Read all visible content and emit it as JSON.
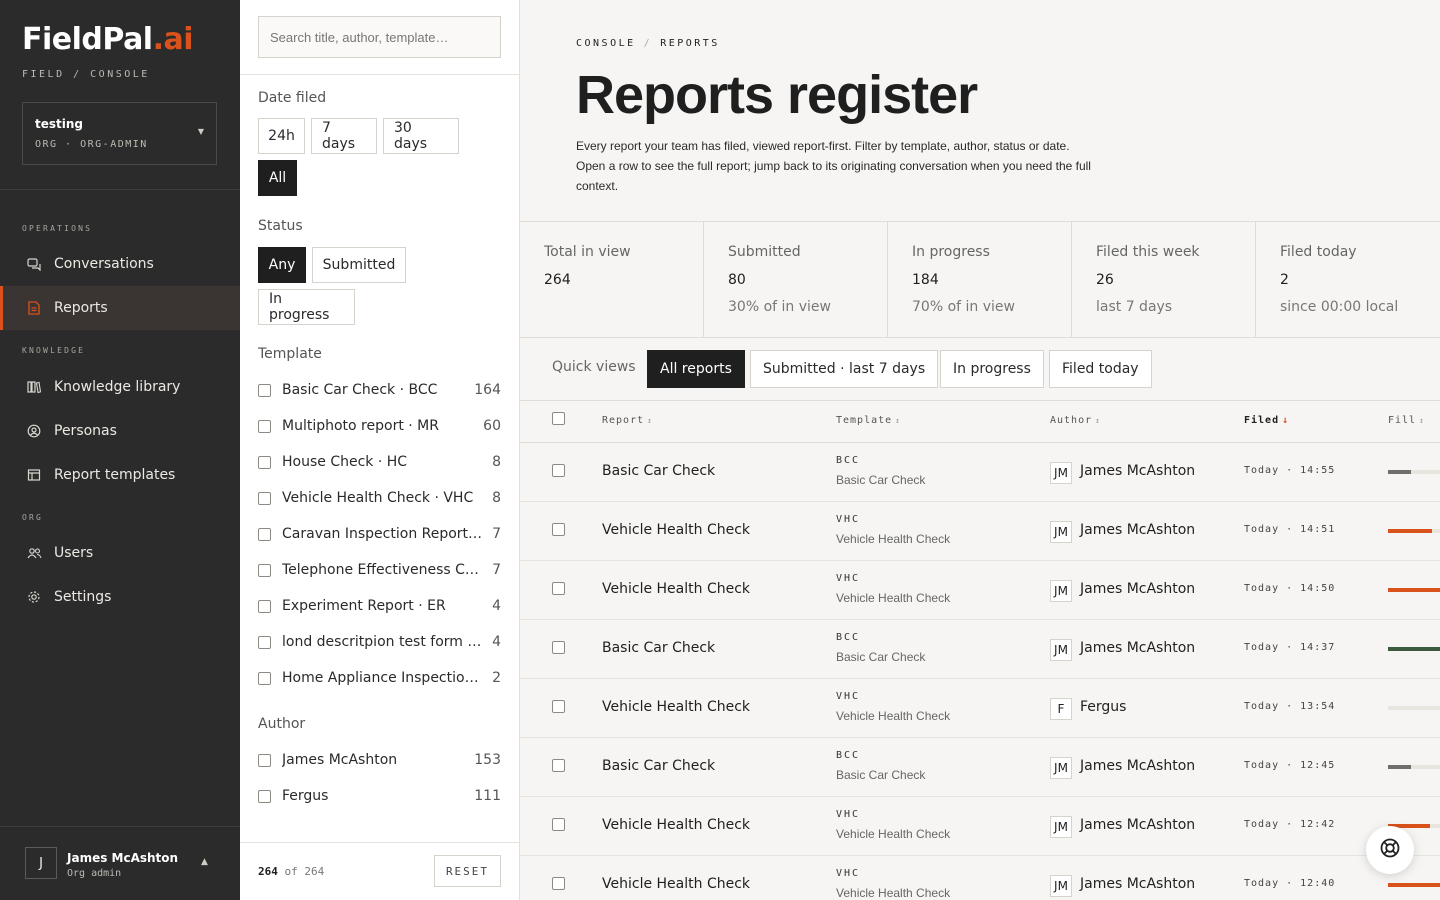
{
  "brand": {
    "name": "FieldPal",
    "suffix": ".ai",
    "subtitle": "FIELD / CONSOLE",
    "accent": "#d9521c"
  },
  "org": {
    "name": "testing",
    "role": "ORG · ORG-ADMIN"
  },
  "nav": {
    "operations_label": "OPERATIONS",
    "knowledge_label": "KNOWLEDGE",
    "org_label": "ORG",
    "items": [
      {
        "label": "Conversations",
        "icon": "chat-icon"
      },
      {
        "label": "Reports",
        "icon": "document-icon",
        "active": true
      },
      {
        "label": "Knowledge library",
        "icon": "library-icon"
      },
      {
        "label": "Personas",
        "icon": "persona-icon"
      },
      {
        "label": "Report templates",
        "icon": "template-icon"
      },
      {
        "label": "Users",
        "icon": "users-icon"
      },
      {
        "label": "Settings",
        "icon": "gear-icon"
      }
    ]
  },
  "user": {
    "initial": "J",
    "name": "James McAshton",
    "role": "Org admin"
  },
  "filters": {
    "search_placeholder": "Search title, author, template…",
    "date_label": "Date filed",
    "date_options": [
      "24h",
      "7 days",
      "30 days",
      "All"
    ],
    "date_selected": "All",
    "status_label": "Status",
    "status_options": [
      "Any",
      "Submitted",
      "In progress"
    ],
    "status_selected": "Any",
    "template_label": "Template",
    "templates": [
      {
        "label": "Basic Car Check · BCC",
        "count": "164"
      },
      {
        "label": "Multiphoto report · MR",
        "count": "60"
      },
      {
        "label": "House Check · HC",
        "count": "8"
      },
      {
        "label": "Vehicle Health Check · VHC",
        "count": "8"
      },
      {
        "label": "Caravan Inspection Report…",
        "count": "7"
      },
      {
        "label": "Telephone Effectiveness C…",
        "count": "7"
      },
      {
        "label": "Experiment Report · ER",
        "count": "4"
      },
      {
        "label": "lond descritpion test form …",
        "count": "4"
      },
      {
        "label": "Home Appliance Inspectio…",
        "count": "2"
      }
    ],
    "author_label": "Author",
    "authors": [
      {
        "label": "James McAshton",
        "count": "153"
      },
      {
        "label": "Fergus",
        "count": "111"
      }
    ],
    "result_shown": "264",
    "result_of": "of",
    "result_total": "264",
    "reset_label": "RESET"
  },
  "page": {
    "breadcrumb": [
      "CONSOLE",
      "REPORTS"
    ],
    "title": "Reports register",
    "description": "Every report your team has filed, viewed report-first. Filter by template, author, status or date. Open a row to see the full report; jump back to its originating conversation when you need the full context."
  },
  "stats": [
    {
      "label": "Total in view",
      "value": "264",
      "sub": ""
    },
    {
      "label": "Submitted",
      "value": "80",
      "sub": "30% of in view"
    },
    {
      "label": "In progress",
      "value": "184",
      "sub": "70% of in view"
    },
    {
      "label": "Filed this week",
      "value": "26",
      "sub": "last 7 days"
    },
    {
      "label": "Filed today",
      "value": "2",
      "sub": "since 00:00 local"
    }
  ],
  "quick_views": {
    "label": "Quick views",
    "options": [
      "All reports",
      "Submitted · last 7 days",
      "In progress",
      "Filed today"
    ],
    "selected": "All reports"
  },
  "table": {
    "columns": [
      "Report",
      "Template",
      "Author",
      "Filed",
      "Fill"
    ],
    "sorted_column": "Filed",
    "rows": [
      {
        "report": "Basic Car Check",
        "code": "BCC",
        "template": "Basic Car Check",
        "initials": "JM",
        "author": "James McAshton",
        "filed": "Today · 14:55",
        "fill": 0.45,
        "fill_color": "#6e6e6e"
      },
      {
        "report": "Vehicle Health Check",
        "code": "VHC",
        "template": "Vehicle Health Check",
        "initials": "JM",
        "author": "James McAshton",
        "filed": "Today · 14:51",
        "fill": 0.85,
        "fill_color": "#d9521c"
      },
      {
        "report": "Vehicle Health Check",
        "code": "VHC",
        "template": "Vehicle Health Check",
        "initials": "JM",
        "author": "James McAshton",
        "filed": "Today · 14:50",
        "fill": 1.0,
        "fill_color": "#d9521c"
      },
      {
        "report": "Basic Car Check",
        "code": "BCC",
        "template": "Basic Car Check",
        "initials": "JM",
        "author": "James McAshton",
        "filed": "Today · 14:37",
        "fill": 1.0,
        "fill_color": "#3c5a3c"
      },
      {
        "report": "Vehicle Health Check",
        "code": "VHC",
        "template": "Vehicle Health Check",
        "initials": "F",
        "author": "Fergus",
        "filed": "Today · 13:54",
        "fill": 0.0,
        "fill_color": "#d9521c"
      },
      {
        "report": "Basic Car Check",
        "code": "BCC",
        "template": "Basic Car Check",
        "initials": "JM",
        "author": "James McAshton",
        "filed": "Today · 12:45",
        "fill": 0.45,
        "fill_color": "#6e6e6e"
      },
      {
        "report": "Vehicle Health Check",
        "code": "VHC",
        "template": "Vehicle Health Check",
        "initials": "JM",
        "author": "James McAshton",
        "filed": "Today · 12:42",
        "fill": 0.8,
        "fill_color": "#d9521c"
      },
      {
        "report": "Vehicle Health Check",
        "code": "VHC",
        "template": "Vehicle Health Check",
        "initials": "JM",
        "author": "James McAshton",
        "filed": "Today · 12:40",
        "fill": 1.0,
        "fill_color": "#d9521c"
      }
    ]
  },
  "help": {
    "icon": "lifebuoy-icon"
  }
}
